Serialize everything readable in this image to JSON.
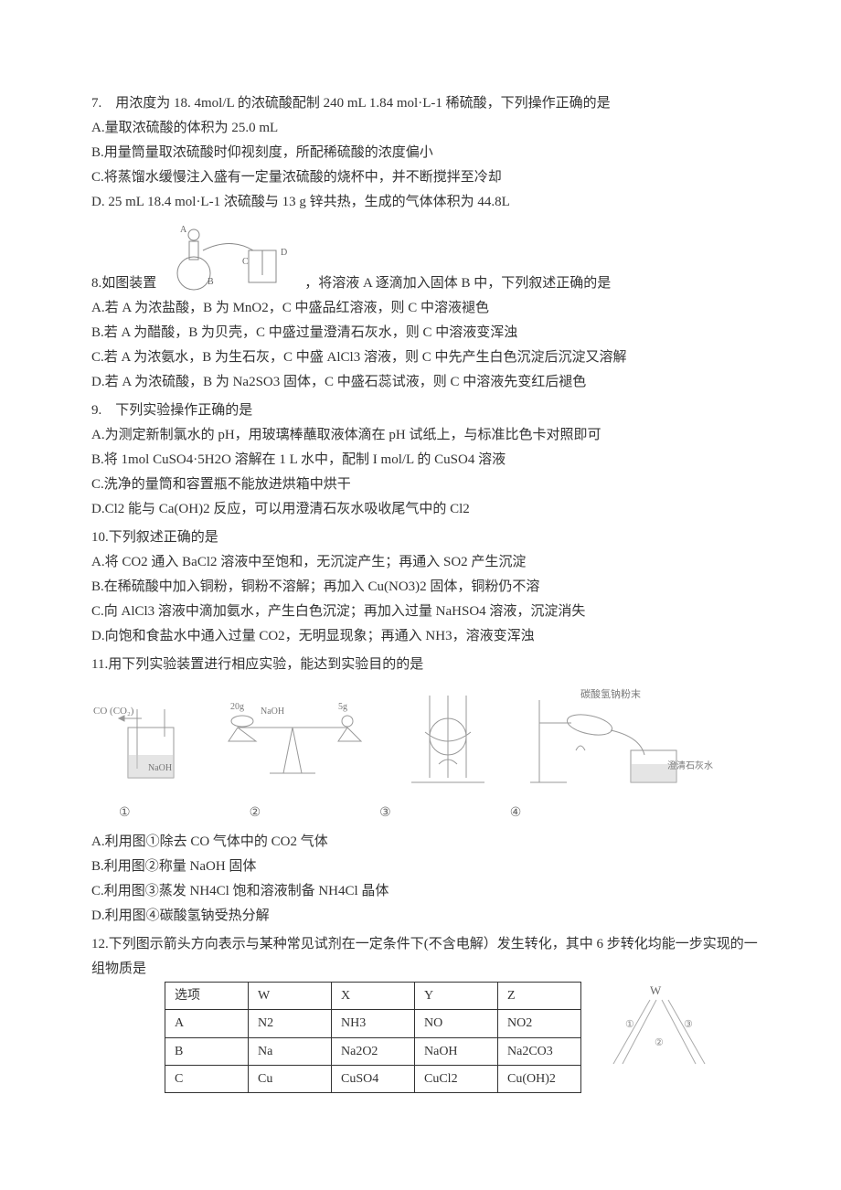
{
  "q7": {
    "stem": "7.　用浓度为 18. 4mol/L 的浓硫酸配制 240 mL 1.84 mol·L-1 稀硫酸，下列操作正确的是",
    "A": "A.量取浓硫酸的体积为 25.0 mL",
    "B": "B.用量筒量取浓硫酸时仰视刻度，所配稀硫酸的浓度偏小",
    "C": "C.将蒸馏水缓慢注入盛有一定量浓硫酸的烧杯中，并不断搅拌至冷却",
    "D": "D. 25 mL 18.4 mol·L-1 浓硫酸与 13 g 锌共热，生成的气体体积为 44.8L"
  },
  "q8": {
    "prefix": "8.如图装置",
    "suffix": "，将溶液 A 逐滴加入固体 B 中，下列叙述正确的是",
    "A": "A.若 A 为浓盐酸，B 为 MnO2，C 中盛品红溶液，则 C 中溶液褪色",
    "B": "B.若 A 为醋酸，B 为贝壳，C 中盛过量澄清石灰水，则 C 中溶液变浑浊",
    "C": "C.若 A 为浓氨水，B 为生石灰，C 中盛 AlCl3 溶液，则 C 中先产生白色沉淀后沉淀又溶解",
    "D": "D.若 A 为浓硫酸，B 为 Na2SO3 固体，C 中盛石蕊试液，则 C 中溶液先变红后褪色"
  },
  "q9": {
    "stem": "9.　下列实验操作正确的是",
    "A": "A.为测定新制氯水的 pH，用玻璃棒蘸取液体滴在 pH 试纸上，与标准比色卡对照即可",
    "B": "B.将 1mol CuSO4·5H2O 溶解在 1 L 水中，配制 I mol/L 的 CuSO4 溶液",
    "C": "C.洗净的量筒和容置瓶不能放进烘箱中烘干",
    "D": "D.Cl2 能与 Ca(OH)2 反应，可以用澄清石灰水吸收尾气中的 Cl2"
  },
  "q10": {
    "stem": "10.下列叙述正确的是",
    "A": "A.将 CO2 通入 BaCl2 溶液中至饱和，无沉淀产生；再通入 SO2 产生沉淀",
    "B": "B.在稀硫酸中加入铜粉，铜粉不溶解；再加入 Cu(NO3)2 固体，铜粉仍不溶",
    "C": "C.向 AlCl3 溶液中滴加氨水，产生白色沉淀；再加入过量 NaHSO4 溶液，沉淀消失",
    "D": "D.向饱和食盐水中通入过量 CO2，无明显现象；再通入 NH3，溶液变浑浊"
  },
  "q11": {
    "stem": "11.用下列实验装置进行相应实验，能达到实验目的的是",
    "labels": {
      "l1": "①",
      "l2": "②",
      "l3": "③",
      "l4": "④"
    },
    "A": "A.利用图①除去 CO 气体中的 CO2 气体",
    "B": "B.利用图②称量 NaOH 固体",
    "C": "C.利用图③蒸发 NH4Cl 饱和溶液制备 NH4Cl 晶体",
    "D": "D.利用图④碳酸氢钠受热分解"
  },
  "q12": {
    "stem": "12.下列图示箭头方向表示与某种常见试剂在一定条件下(不含电解）发生转化，其中 6 步转化均能一步实现的一组物质是",
    "headers": {
      "h0": "选项",
      "h1": "W",
      "h2": "X",
      "h3": "Y",
      "h4": "Z"
    },
    "rows": [
      {
        "c0": "A",
        "c1": "N2",
        "c2": "NH3",
        "c3": "NO",
        "c4": "NO2"
      },
      {
        "c0": "B",
        "c1": "Na",
        "c2": "Na2O2",
        "c3": "NaOH",
        "c4": "Na2CO3"
      },
      {
        "c0": "C",
        "c1": "Cu",
        "c2": "CuSO4",
        "c3": "CuCl2",
        "c4": "Cu(OH)2"
      }
    ]
  },
  "captions": {
    "d1_gas": "CO (CO₂)",
    "d1_sol": "NaOH",
    "d2_left": "20g",
    "d2_right": "5g",
    "d2_naoh": "NaOH",
    "d4_powder": "碳酸氢钠粉末",
    "d4_lime": "澄清石灰水",
    "d12_w": "W"
  }
}
